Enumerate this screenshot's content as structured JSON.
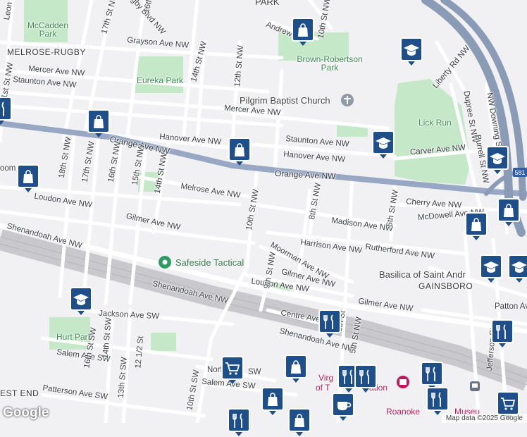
{
  "map": {
    "parks": [
      "McCadden Park",
      "Eureka Park",
      "Brown-Robertson Park",
      "Lick Run",
      "Hurt Park"
    ],
    "neighborhoods": [
      "MELROSE-RUGBY",
      "GAINSBORO",
      "EST END"
    ],
    "places": {
      "pilgrim": "Pilgrim Baptist Church",
      "safeside": "Safeside Tactical",
      "basilica": "Basilica of Saint Andr",
      "museum1": "Virg",
      "museum2": "um",
      "museum3": "of T",
      "museum4": "ation",
      "roanoke": "Roanoke",
      "museum5": "Museu",
      "topclip": "PARK",
      "shield": "581"
    },
    "streets": {
      "orange_ave_1": "Orange Ave NW",
      "orange_ave_2": "Orange Ave NW",
      "grayson": "Grayson Ave NW",
      "mercer": "Mercer Ave NW",
      "staunton_w": "Staunton Ave NW",
      "staunton_e": "Staunton Ave NW",
      "hanover_w": "Hanover Ave NW",
      "hanover_e": "Hanover Ave NW",
      "melrose": "Melrose Ave NW",
      "loudon_w": "Loudon Ave NW",
      "loudon_e": "Loudon Ave NW",
      "gilmer_w": "Gilmer Ave NW",
      "gilmer_m": "Gilmer Ave NW",
      "gilmer_e": "Gilmer Ave NW",
      "shenandoah_w": "Shenandoah Ave NW",
      "shenandoah_m": "Shenandoah Ave NW",
      "shenandoah_e": "Shenandoah Ave NW",
      "moorman": "Moorman Ave NW",
      "harrison": "Harrison Ave NW",
      "rutherford": "Rutherford Ave NW",
      "madison": "Madison Ave NW",
      "cherry": "Cherry Ave NW",
      "mcdowell": "McDowell Ave NW",
      "carver": "Carver Ave NW",
      "centre": "Centre Ave",
      "patton": "Patton Ave",
      "liberty": "Liberty Rd NW",
      "andrews": "Andrews",
      "rugby_blvd": "Rugby Blvd NW",
      "jackson": "Jackson Ave SW",
      "salem_w": "Salem Ave SW",
      "salem_e": "Salem Ave SW",
      "patterson": "Patterson Ave SW",
      "norfolk": "Norf",
      "norfolk2": "SW",
      "st21": "21st St NW",
      "st18": "18th St NW",
      "st17": "17th St NW",
      "st16": "16th St NW",
      "st15": "15th St NW",
      "st14": "14th St NW",
      "st12": "12th St NW",
      "st10": "10th St NW",
      "st10_top": "10th St NW",
      "st9": "9th St NW",
      "st8": "8th St NW",
      "st5": "5th St NW",
      "st5b": "5th St",
      "st5c": "5th St NW",
      "st14_top": "14th St NW",
      "st16_top": "16th",
      "st17_top": "17th St NW",
      "st14sw": "14th St SW",
      "st13sw": "13th St SW",
      "st12sw": "12 1/2 St",
      "st10sw": "10th St SW",
      "st16sw": "16th St SW",
      "dupree": "Dupree St NW",
      "burrell": "Burrell St NW",
      "downing": "NW Downing St",
      "jefferson": "Jefferson St",
      "leon": "Leon",
      "loom": "oom"
    },
    "attribution": "Map data ©2025 Google",
    "logo": "Google",
    "colors": {
      "background": "#f1f0f3",
      "park": "#c5e8c8",
      "highway": "#8a9bb6",
      "major_road": "#98a8c4",
      "marker": "#1e4f8a",
      "rail": "#c9c9cd"
    },
    "markers": [
      {
        "icon": "shopping-bag-icon"
      },
      {
        "icon": "graduation-cap-icon"
      },
      {
        "icon": "shopping-bag-icon"
      },
      {
        "icon": "shopping-bag-icon"
      },
      {
        "icon": "graduation-cap-icon"
      },
      {
        "icon": "shopping-bag-icon"
      },
      {
        "icon": "graduation-cap-icon"
      },
      {
        "icon": "shopping-bag-icon"
      },
      {
        "icon": "shopping-bag-icon"
      },
      {
        "icon": "graduation-cap-icon"
      },
      {
        "icon": "graduation-cap-icon"
      },
      {
        "icon": "graduation-cap-icon"
      },
      {
        "icon": "restaurant-icon"
      },
      {
        "icon": "restaurant-icon"
      },
      {
        "icon": "shopping-cart-icon"
      },
      {
        "icon": "shopping-bag-icon"
      },
      {
        "icon": "restaurant-icon"
      },
      {
        "icon": "restaurant-icon"
      },
      {
        "icon": "restaurant-icon"
      },
      {
        "icon": "restaurant-icon"
      },
      {
        "icon": "shopping-bag-icon"
      },
      {
        "icon": "cafe-icon"
      },
      {
        "icon": "restaurant-icon"
      },
      {
        "icon": "shopping-bag-icon"
      },
      {
        "icon": "restaurant-icon"
      },
      {
        "icon": "shopping-cart-icon"
      }
    ]
  }
}
